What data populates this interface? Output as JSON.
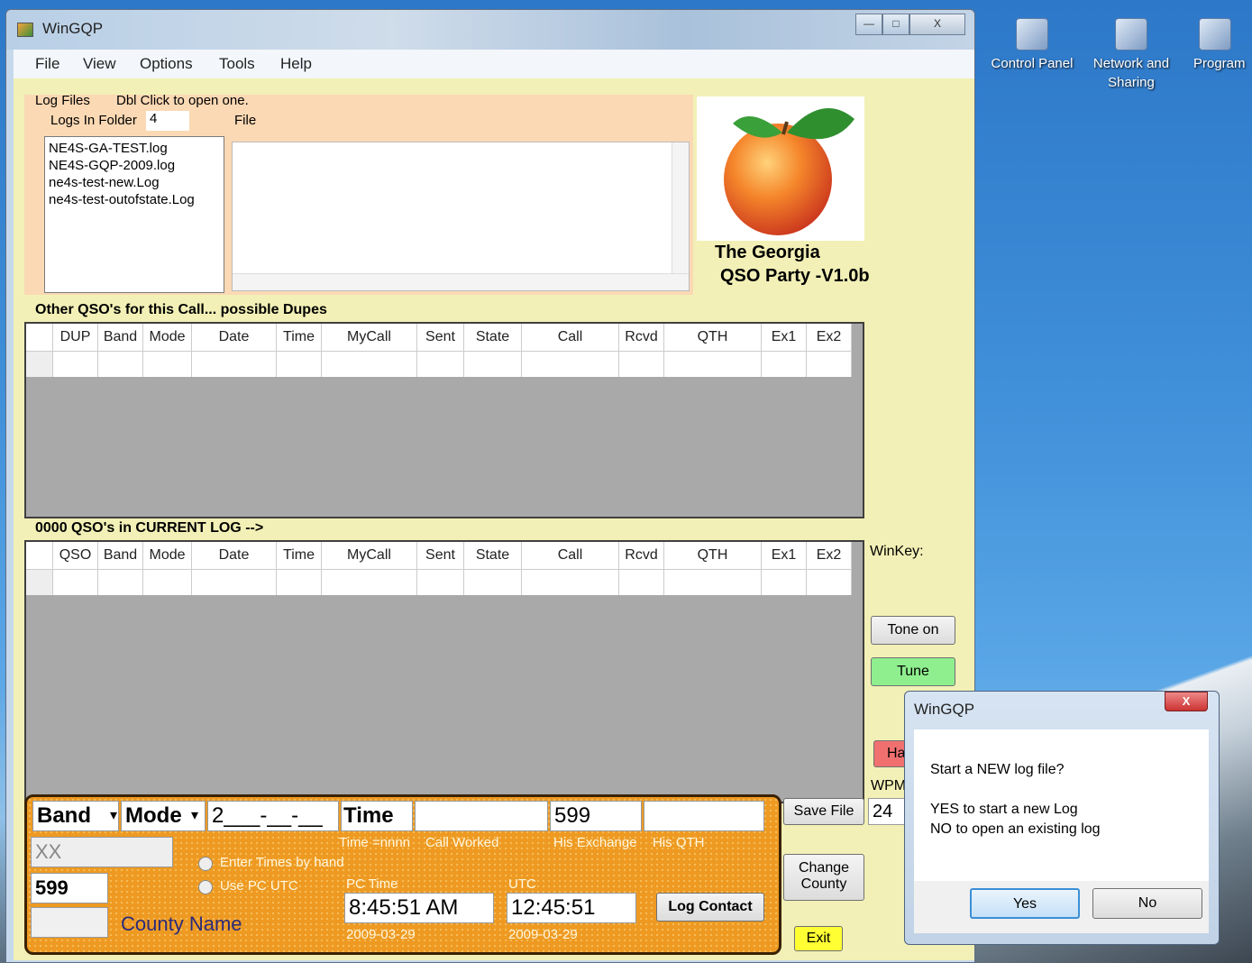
{
  "desktop": {
    "icons": [
      {
        "label": "Control Panel"
      },
      {
        "label": "Network and Sharing"
      },
      {
        "label": "Program"
      }
    ]
  },
  "window": {
    "title": "WinGQP",
    "caption_buttons": {
      "minimize": "—",
      "maximize": "□",
      "close": "X"
    }
  },
  "menu": {
    "items": [
      "File",
      "View",
      "Options",
      "Tools",
      "Help"
    ]
  },
  "log_files": {
    "header": "Log Files",
    "hint": "Dbl Click to open one.",
    "logs_in_folder_label": "Logs In Folder",
    "logs_in_folder_value": "4",
    "file_label": "File",
    "files": [
      "NE4S-GA-TEST.log",
      "NE4S-GQP-2009.log",
      "ne4s-test-new.Log",
      "ne4s-test-outofstate.Log"
    ]
  },
  "logo": {
    "line1": "The Georgia",
    "line2": "QSO Party -V1.0b"
  },
  "dupes": {
    "title": "Other QSO's for this Call... possible Dupes",
    "columns": [
      "",
      "DUP",
      "Band",
      "Mode",
      "Date",
      "Time",
      "MyCall",
      "Sent",
      "State",
      "Call",
      "Rcvd",
      "QTH",
      "Ex1",
      "Ex2"
    ]
  },
  "current_log": {
    "title": "0000 QSO's in CURRENT LOG -->",
    "columns": [
      "",
      "QSO",
      "Band",
      "Mode",
      "Date",
      "Time",
      "MyCall",
      "Sent",
      "State",
      "Call",
      "Rcvd",
      "QTH",
      "Ex1",
      "Ex2"
    ]
  },
  "winkey": {
    "label": "WinKey:",
    "tone_on": "Tone on",
    "tune": "Tune",
    "halt_partial": "Ha",
    "wpm_label": "WPM",
    "wpm_value": "24"
  },
  "entry": {
    "band": "Band",
    "mode": "Mode",
    "date_mask": "2___-__-__",
    "time": "Time",
    "call_worked": "",
    "his_exchange": "599",
    "his_qth": "",
    "hint_time": "Time =nnnn",
    "hint_call": "Call Worked",
    "hint_exchange": "His Exchange",
    "hint_qth": "His QTH",
    "xx": "XX",
    "sent_rst": "599",
    "county_code": "",
    "county_name": "County Name",
    "radio_enter_times": "Enter Times by hand",
    "radio_use_utc": "Use PC UTC",
    "pc_time_label": "PC Time",
    "pc_time_value": "8:45:51 AM",
    "pc_date": "2009-03-29",
    "utc_label": "UTC",
    "utc_value": "12:45:51",
    "utc_date": "2009-03-29",
    "log_contact": "Log Contact"
  },
  "side_buttons": {
    "save_file": "Save File",
    "change_county": "Change County",
    "exit": "Exit"
  },
  "dialog": {
    "title": "WinGQP",
    "message": "Start a NEW log file?",
    "line2": "YES to start a new Log",
    "line3": "NO to open an existing log",
    "yes": "Yes",
    "no": "No",
    "close": "X"
  },
  "colors": {
    "client_bg": "#f2f0b6",
    "log_panel_bg": "#fbd9b4",
    "entry_bg": "#ee9a22",
    "tune_green": "#8fef8f",
    "exit_yellow": "#ffff33",
    "halt_red": "#f07070"
  }
}
